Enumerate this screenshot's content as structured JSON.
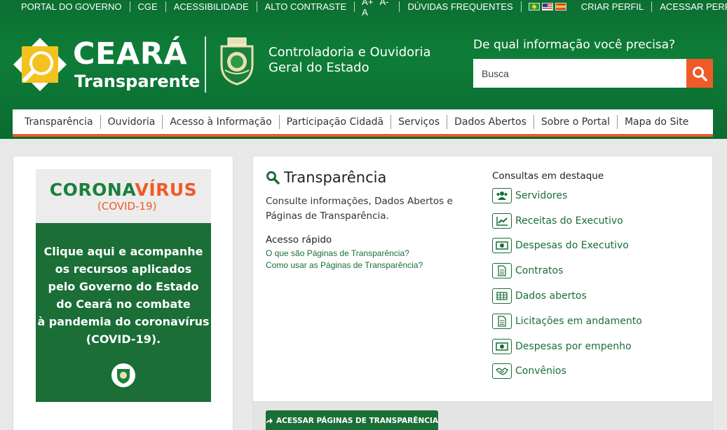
{
  "topbar": {
    "left_items": [
      "PORTAL DO GOVERNO",
      "CGE",
      "ACESSIBILIDADE",
      "ALTO CONTRASTE"
    ],
    "font_controls": [
      "A+",
      "A-",
      "A"
    ],
    "faq": "DÚVIDAS FREQUENTES",
    "right_items": [
      "CRIAR PERFIL",
      "ACESSAR PERFIL"
    ]
  },
  "logo": {
    "line1": "CEARÁ",
    "line2": "Transparente"
  },
  "org": {
    "name": "Controladoria e Ouvidoria Geral do Estado"
  },
  "search": {
    "label": "De qual informação você precisa?",
    "placeholder": "Busca"
  },
  "nav": [
    "Transparência",
    "Ouvidoria",
    "Acesso à Informação",
    "Participação Cidadã",
    "Serviços",
    "Dados Abertos",
    "Sobre o Portal",
    "Mapa do Site"
  ],
  "banner": {
    "title_green": "CORONA",
    "title_orange": "VÍRUS",
    "subtitle": "(COVID-19)",
    "text": "Clique aqui e acompanhe\nos recursos aplicados\npelo Governo do Estado\ndo Ceará no combate\nà pandemia do coronavírus\n(COVID-19)."
  },
  "main": {
    "title": "Transparência",
    "description": "Consulte informações, Dados Abertos e Páginas de Transparência.",
    "quick_title": "Acesso rápido",
    "quick_links": [
      "O que são Páginas de Transparência?",
      "Como usar as Páginas de Transparência?"
    ],
    "consults_title": "Consultas em destaque",
    "consults": [
      {
        "label": "Servidores",
        "icon": "users-icon"
      },
      {
        "label": "Receitas do Executivo",
        "icon": "chart-icon"
      },
      {
        "label": "Despesas do Executivo",
        "icon": "money-icon"
      },
      {
        "label": "Contratos",
        "icon": "document-icon"
      },
      {
        "label": "Dados abertos",
        "icon": "table-icon"
      },
      {
        "label": "Licitações em andamento",
        "icon": "document-icon"
      },
      {
        "label": "Despesas por empenho",
        "icon": "money-icon"
      },
      {
        "label": "Convênios",
        "icon": "handshake-icon"
      }
    ],
    "access_button": "ACESSAR PÁGINAS DE TRANSPARÊNCIA"
  },
  "colors": {
    "green": "#0e7d38",
    "dark_green": "#1a6e36",
    "orange": "#f05a28"
  }
}
